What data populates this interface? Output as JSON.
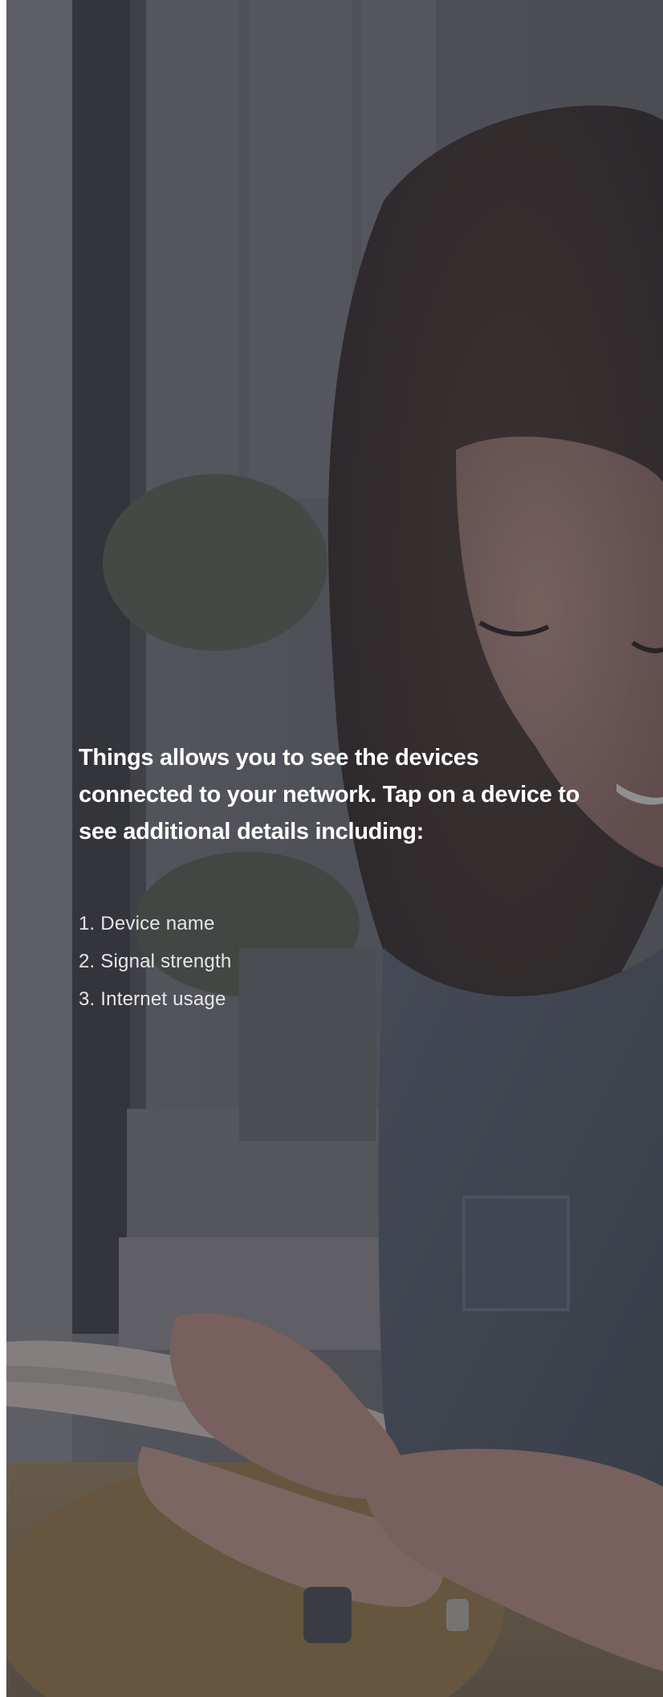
{
  "onboarding": {
    "headline": "Things allows you to see the devices connected to your network. Tap on a device to see additional details including:",
    "features": [
      "1. Device name",
      "2. Signal strength",
      "3. Internet usage"
    ]
  },
  "background": {
    "image": "woman-with-tablet-photo",
    "overlay_color": "#28282e"
  }
}
